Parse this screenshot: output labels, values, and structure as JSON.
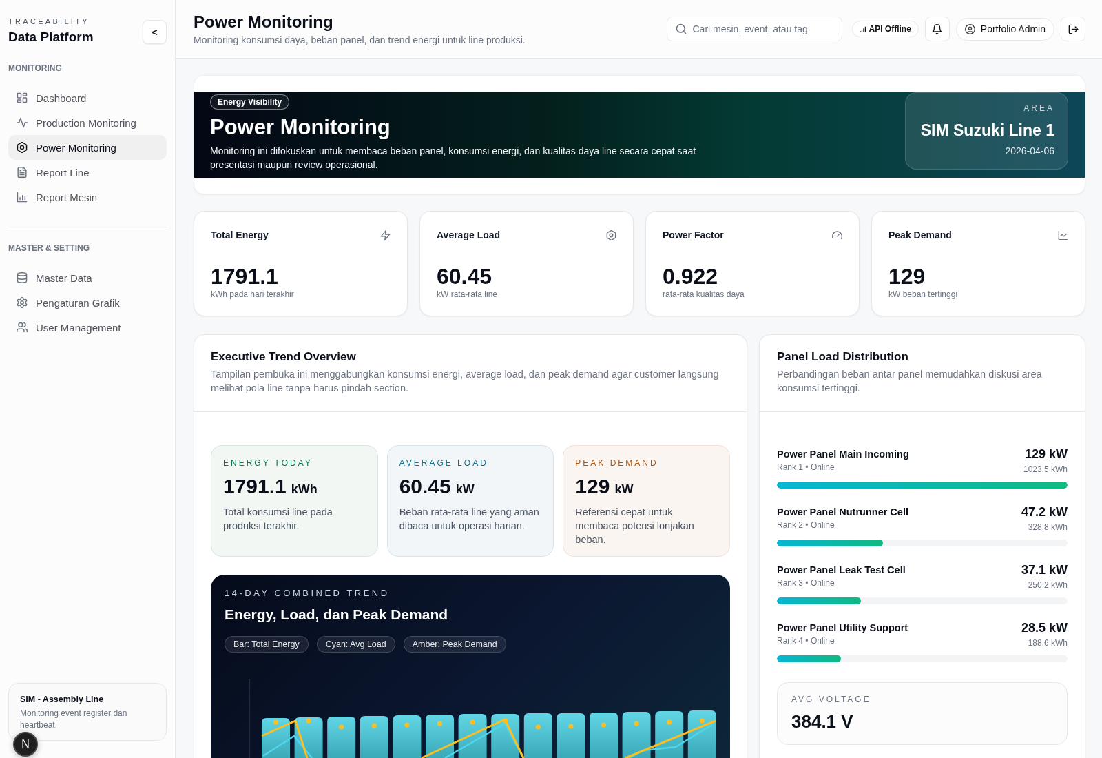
{
  "sidebar": {
    "brand_caption": "TRACEABILITY",
    "brand_title": "Data Platform",
    "collapse_button": "<",
    "sections": [
      {
        "heading": "MONITORING",
        "items": [
          {
            "label": "Dashboard",
            "selected": false
          },
          {
            "label": "Production Monitoring",
            "selected": false
          },
          {
            "label": "Power Monitoring",
            "selected": true
          },
          {
            "label": "Report Line",
            "selected": false
          },
          {
            "label": "Report Mesin",
            "selected": false
          }
        ]
      },
      {
        "heading": "MASTER & SETTING",
        "items": [
          {
            "label": "Master Data",
            "selected": false
          },
          {
            "label": "Pengaturan Grafik",
            "selected": false
          },
          {
            "label": "User Management",
            "selected": false
          }
        ]
      }
    ],
    "footer_card": {
      "title": "SIM - Assembly Line",
      "text": "Monitoring event register dan heartbeat."
    }
  },
  "header": {
    "title": "Power Monitoring",
    "subtitle": "Monitoring konsumsi daya, beban panel, dan trend energi untuk line produksi.",
    "search": {
      "placeholder": "Cari mesin, event, atau tag"
    },
    "api_status": "API Offline",
    "user": "Portfolio Admin"
  },
  "banner": {
    "tag": "Energy Visibility",
    "title": "Power Monitoring",
    "description": "Monitoring ini difokuskan untuk membaca beban panel, konsumsi energi, dan kualitas daya line secara cepat saat presentasi maupun review operasional.",
    "area": {
      "label": "AREA",
      "name": "SIM Suzuki Line 1",
      "date": "2026-04-06"
    }
  },
  "stats": [
    {
      "label": "Total Energy",
      "value": "1791.1",
      "caption": "kWh pada hari terakhir"
    },
    {
      "label": "Average Load",
      "value": "60.45",
      "caption": "kW rata-rata line"
    },
    {
      "label": "Power Factor",
      "value": "0.922",
      "caption": "rata-rata kualitas daya"
    },
    {
      "label": "Peak Demand",
      "value": "129",
      "caption": "kW beban tertinggi"
    }
  ],
  "trend": {
    "title": "Executive Trend Overview",
    "description": "Tampilan pembuka ini menggabungkan konsumsi energi, average load, dan peak demand agar customer langsung melihat pola line tanpa harus pindah section.",
    "highlights": [
      {
        "label": "ENERGY TODAY",
        "value": "1791.1",
        "unit": "kWh",
        "text": "Total konsumsi line pada produksi terakhir.",
        "color": "#047857"
      },
      {
        "label": "AVERAGE LOAD",
        "value": "60.45",
        "unit": "kW",
        "text": "Beban rata-rata line yang aman dibaca untuk operasi harian.",
        "color": "#0e7490"
      },
      {
        "label": "PEAK DEMAND",
        "value": "129",
        "unit": "kW",
        "text": "Referensi cepat untuk membaca potensi lonjakan beban.",
        "color": "#b45309"
      }
    ],
    "chart": {
      "eyebrow": "14-DAY COMBINED TREND",
      "title": "Energy, Load, dan Peak Demand",
      "legend": [
        "Bar: Total Energy",
        "Cyan: Avg Load",
        "Amber: Peak Demand"
      ]
    }
  },
  "panels": {
    "title": "Panel Load Distribution",
    "description": "Perbandingan beban antar panel memudahkan diskusi area konsumsi tertinggi.",
    "items": [
      {
        "name": "Power Panel Main Incoming",
        "meta": "Rank 1 • Online",
        "power": "129 kW",
        "energy": "1023.5 kWh",
        "level": 1.0
      },
      {
        "name": "Power Panel Nutrunner Cell",
        "meta": "Rank 2 • Online",
        "power": "47.2 kW",
        "energy": "328.8 kWh",
        "level": 0.366
      },
      {
        "name": "Power Panel Leak Test Cell",
        "meta": "Rank 3 • Online",
        "power": "37.1 kW",
        "energy": "250.2 kWh",
        "level": 0.288
      },
      {
        "name": "Power Panel Utility Support",
        "meta": "Rank 4 • Online",
        "power": "28.5 kW",
        "energy": "188.6 kWh",
        "level": 0.221
      }
    ],
    "avg_voltage": {
      "label": "AVG VOLTAGE",
      "value": "384.1 V"
    }
  },
  "dev_indicator": "N"
}
